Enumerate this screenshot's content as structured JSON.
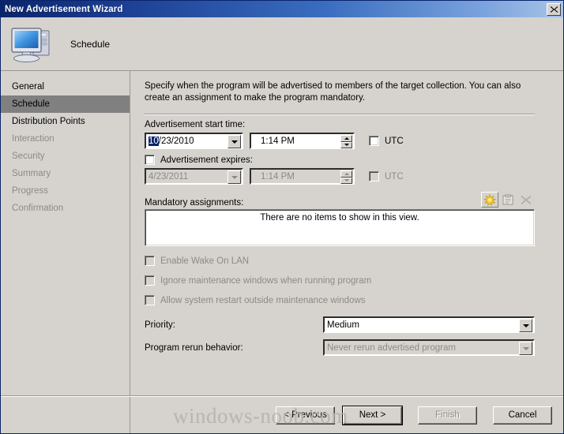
{
  "window": {
    "title": "New Advertisement Wizard",
    "close_icon": "close-icon"
  },
  "header": {
    "icon": "computer-icon",
    "title": "Schedule"
  },
  "sidebar": {
    "items": [
      {
        "label": "General",
        "state": "done"
      },
      {
        "label": "Schedule",
        "state": "selected"
      },
      {
        "label": "Distribution Points",
        "state": "done"
      },
      {
        "label": "Interaction",
        "state": "disabled"
      },
      {
        "label": "Security",
        "state": "disabled"
      },
      {
        "label": "Summary",
        "state": "disabled"
      },
      {
        "label": "Progress",
        "state": "disabled"
      },
      {
        "label": "Confirmation",
        "state": "disabled"
      }
    ]
  },
  "content": {
    "intro": "Specify when the program will be advertised to members of the target collection. You can also create an assignment to make the program mandatory.",
    "start_time_label": "Advertisement start time:",
    "start_date_selected": "10",
    "start_date_rest": "/23/2010",
    "start_time_value": "1:14 PM",
    "start_utc_label": "UTC",
    "expires_label": "Advertisement expires:",
    "expires_date_value": "4/23/2011",
    "expires_time_value": "1:14 PM",
    "expires_utc_label": "UTC",
    "mandatory_label": "Mandatory assignments:",
    "listview_empty": "There are no items to show in this view.",
    "toolbar": {
      "new_icon": "new-star-icon",
      "properties_icon": "properties-icon",
      "delete_icon": "delete-x-icon"
    },
    "checkboxes": [
      {
        "label": "Enable Wake On LAN",
        "checked": false,
        "disabled": true
      },
      {
        "label": "Ignore maintenance windows when running program",
        "checked": false,
        "disabled": true
      },
      {
        "label": "Allow system restart outside maintenance windows",
        "checked": false,
        "disabled": true
      }
    ],
    "priority_label": "Priority:",
    "priority_value": "Medium",
    "rerun_label": "Program rerun behavior:",
    "rerun_value": "Never rerun advertised program"
  },
  "buttons": {
    "previous": "< Previous",
    "next": "Next >",
    "finish": "Finish",
    "cancel": "Cancel"
  },
  "watermark": "windows-noob.com",
  "colors": {
    "titlebar_start": "#0a246a",
    "titlebar_end": "#a8c4e8",
    "dialog_bg": "#d6d3ce",
    "selection_blue": "#0a246a",
    "disabled_text": "#8c8a85",
    "nav_selected_bg": "#808080"
  }
}
